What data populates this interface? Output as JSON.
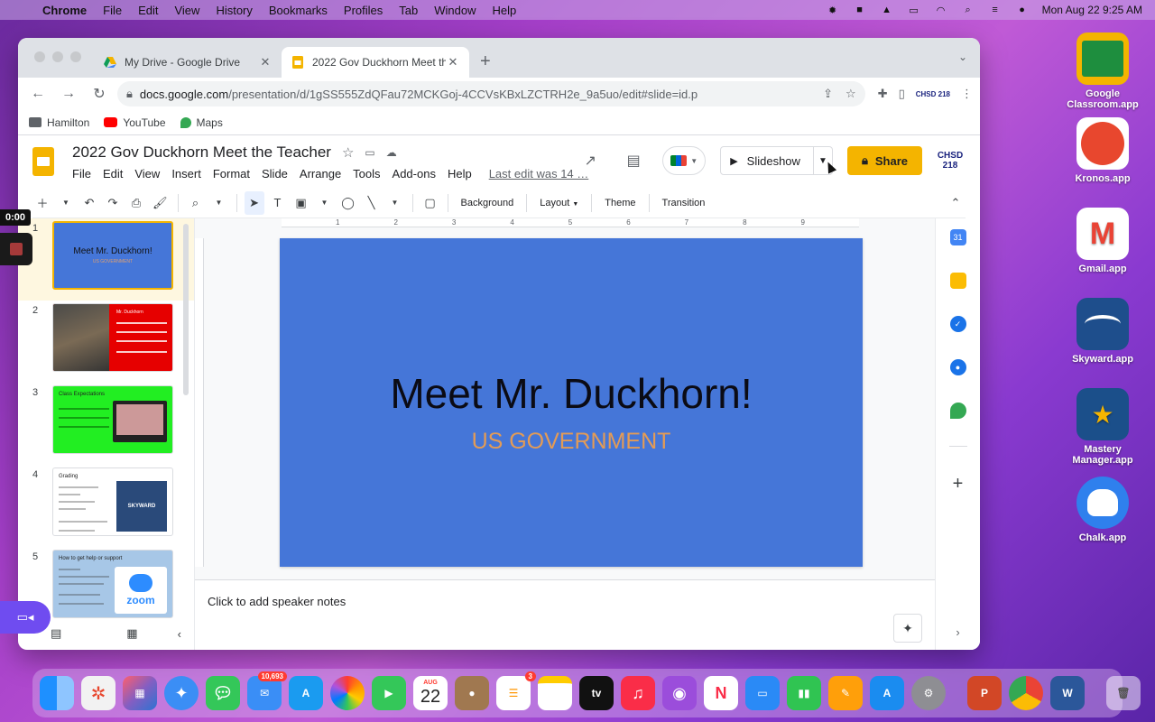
{
  "menubar": {
    "app": "Chrome",
    "items": [
      "File",
      "Edit",
      "View",
      "History",
      "Bookmarks",
      "Profiles",
      "Tab",
      "Window",
      "Help"
    ],
    "datetime": "Mon Aug 22  9:25 AM"
  },
  "desktop": {
    "icons": [
      {
        "label": "Google Classroom.app",
        "color": "#1e8e3e"
      },
      {
        "label": "Kronos.app",
        "color": "#e8472e"
      },
      {
        "label": "Gmail.app",
        "color": "#ea4335"
      },
      {
        "label": "Skyward.app",
        "color": "#1e4e8c"
      },
      {
        "label": "Mastery Manager.app",
        "color": "#1b4f8a"
      },
      {
        "label": "Chalk.app",
        "color": "#2f80ed"
      }
    ]
  },
  "browser": {
    "tabs": [
      {
        "title": "My Drive - Google Drive",
        "active": false
      },
      {
        "title": "2022 Gov Duckhorn Meet the T",
        "active": true
      }
    ],
    "url_host": "docs.google.com",
    "url_path": "/presentation/d/1gSS555ZdQFau72MCKGoj-4CCVsKBxLZCTRH2e_9a5uo/edit#slide=id.p",
    "bookmarks": [
      "Hamilton",
      "YouTube",
      "Maps"
    ]
  },
  "slides": {
    "doc_title": "2022 Gov Duckhorn Meet the Teacher",
    "menus": [
      "File",
      "Edit",
      "View",
      "Insert",
      "Format",
      "Slide",
      "Arrange",
      "Tools",
      "Add-ons",
      "Help"
    ],
    "last_edit": "Last edit was 14 …",
    "slideshow_label": "Slideshow",
    "share_label": "Share",
    "account_label": "CHSD 218",
    "toolbar": {
      "background_label": "Background",
      "layout_label": "Layout",
      "theme_label": "Theme",
      "transition_label": "Transition"
    },
    "ruler_marks": [
      "1",
      "2",
      "3",
      "4",
      "5",
      "6",
      "7",
      "8",
      "9"
    ],
    "thumbnails": [
      {
        "num": "1",
        "title": "Meet Mr. Duckhorn!",
        "subtitle": "US GOVERNMENT"
      },
      {
        "num": "2",
        "title": "Mr. Duckhorn"
      },
      {
        "num": "3",
        "title": "Class Expectations"
      },
      {
        "num": "4",
        "title": "Grading",
        "logo": "SKYWARD"
      },
      {
        "num": "5",
        "title": "How to get help or support",
        "logo": "zoom"
      }
    ],
    "current_slide": {
      "title": "Meet Mr. Duckhorn!",
      "subtitle": "US GOVERNMENT"
    },
    "speaker_notes_placeholder": "Click to add speaker notes"
  },
  "recording": {
    "timer": "0:00"
  },
  "dock": {
    "mail_badge": "10,693",
    "calendar_month": "AUG",
    "calendar_day": "22",
    "reminders_badge": "3",
    "tv_label": "tv"
  }
}
